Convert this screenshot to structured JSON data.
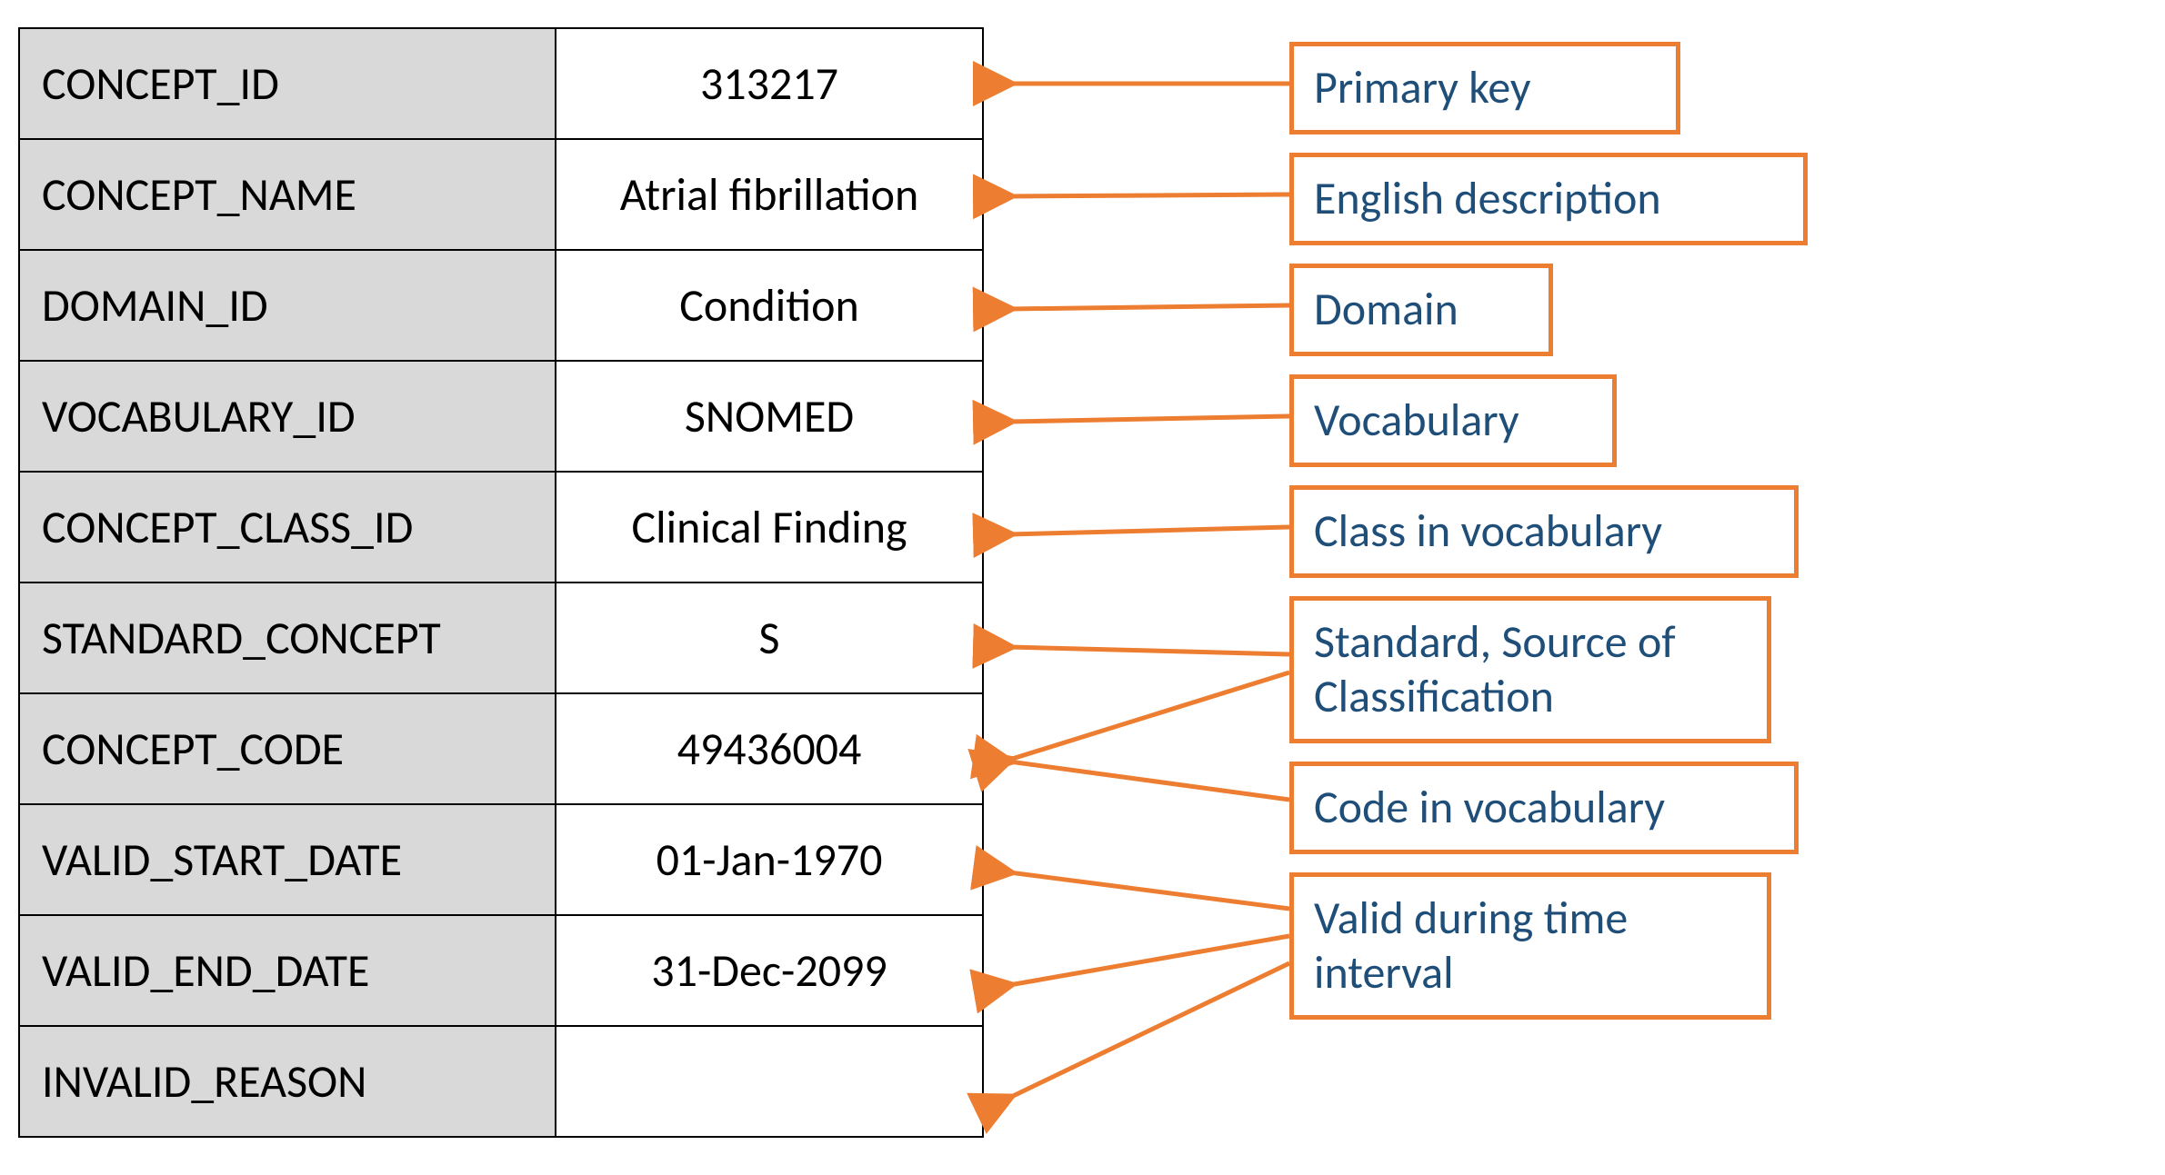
{
  "table": {
    "rows": [
      {
        "key": "CONCEPT_ID",
        "value": "313217"
      },
      {
        "key": "CONCEPT_NAME",
        "value": "Atrial fibrillation"
      },
      {
        "key": "DOMAIN_ID",
        "value": "Condition"
      },
      {
        "key": "VOCABULARY_ID",
        "value": "SNOMED"
      },
      {
        "key": "CONCEPT_CLASS_ID",
        "value": "Clinical Finding"
      },
      {
        "key": "STANDARD_CONCEPT",
        "value": "S"
      },
      {
        "key": "CONCEPT_CODE",
        "value": "49436004"
      },
      {
        "key": "VALID_START_DATE",
        "value": "01-Jan-1970"
      },
      {
        "key": "VALID_END_DATE",
        "value": "31-Dec-2099"
      },
      {
        "key": "INVALID_REASON",
        "value": ""
      }
    ]
  },
  "annotations": [
    {
      "text": "Primary key"
    },
    {
      "text": "English description"
    },
    {
      "text": "Domain"
    },
    {
      "text": "Vocabulary"
    },
    {
      "text": "Class in vocabulary"
    },
    {
      "text": "Standard, Source of Classification"
    },
    {
      "text": "Code in vocabulary"
    },
    {
      "text": "Valid during time interval"
    }
  ],
  "colors": {
    "annotation_border": "#ed7d31",
    "annotation_text": "#1f4e79",
    "table_key_fill": "#d9d9d9",
    "arrow": "#ed7d31"
  }
}
